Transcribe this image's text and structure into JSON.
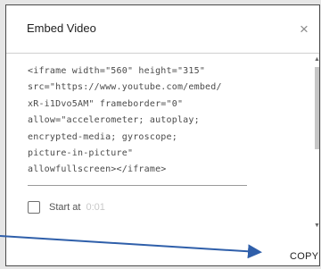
{
  "dialog": {
    "title": "Embed Video",
    "close_glyph": "×",
    "code_lines": [
      "<iframe width=\"560\" height=\"315\"",
      "src=\"https://www.youtube.com/embed/",
      "xR-i1Dvo5AM\" frameborder=\"0\"",
      "allow=\"accelerometer; autoplay;",
      "encrypted-media; gyroscope;",
      "picture-in-picture\"",
      "allowfullscreen></iframe>"
    ],
    "start_at_label": "Start at",
    "start_at_time": "0:01",
    "copy_label": "COPY"
  },
  "annotation": {
    "arrow_color": "#2f5faa",
    "arrow_icon": "annotation-arrow"
  }
}
